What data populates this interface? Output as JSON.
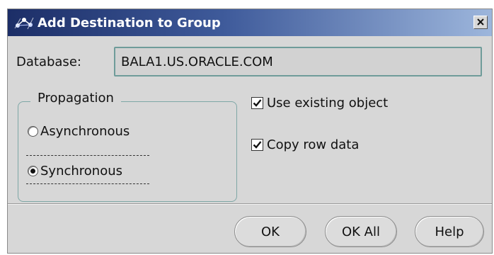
{
  "window": {
    "title": "Add Destination to Group",
    "title_icon": "replication-icon",
    "close_icon": "close-icon"
  },
  "database": {
    "label": "Database:",
    "value": "BALA1.US.ORACLE.COM"
  },
  "propagation": {
    "group_label": "Propagation",
    "options": [
      {
        "label": "Asynchronous",
        "selected": false
      },
      {
        "label": "Synchronous",
        "selected": true
      }
    ]
  },
  "options": {
    "use_existing_object": {
      "label": "Use existing object",
      "checked": true
    },
    "copy_row_data": {
      "label": "Copy row data",
      "checked": true
    }
  },
  "buttons": {
    "ok": "OK",
    "ok_all": "OK All",
    "help": "Help"
  }
}
